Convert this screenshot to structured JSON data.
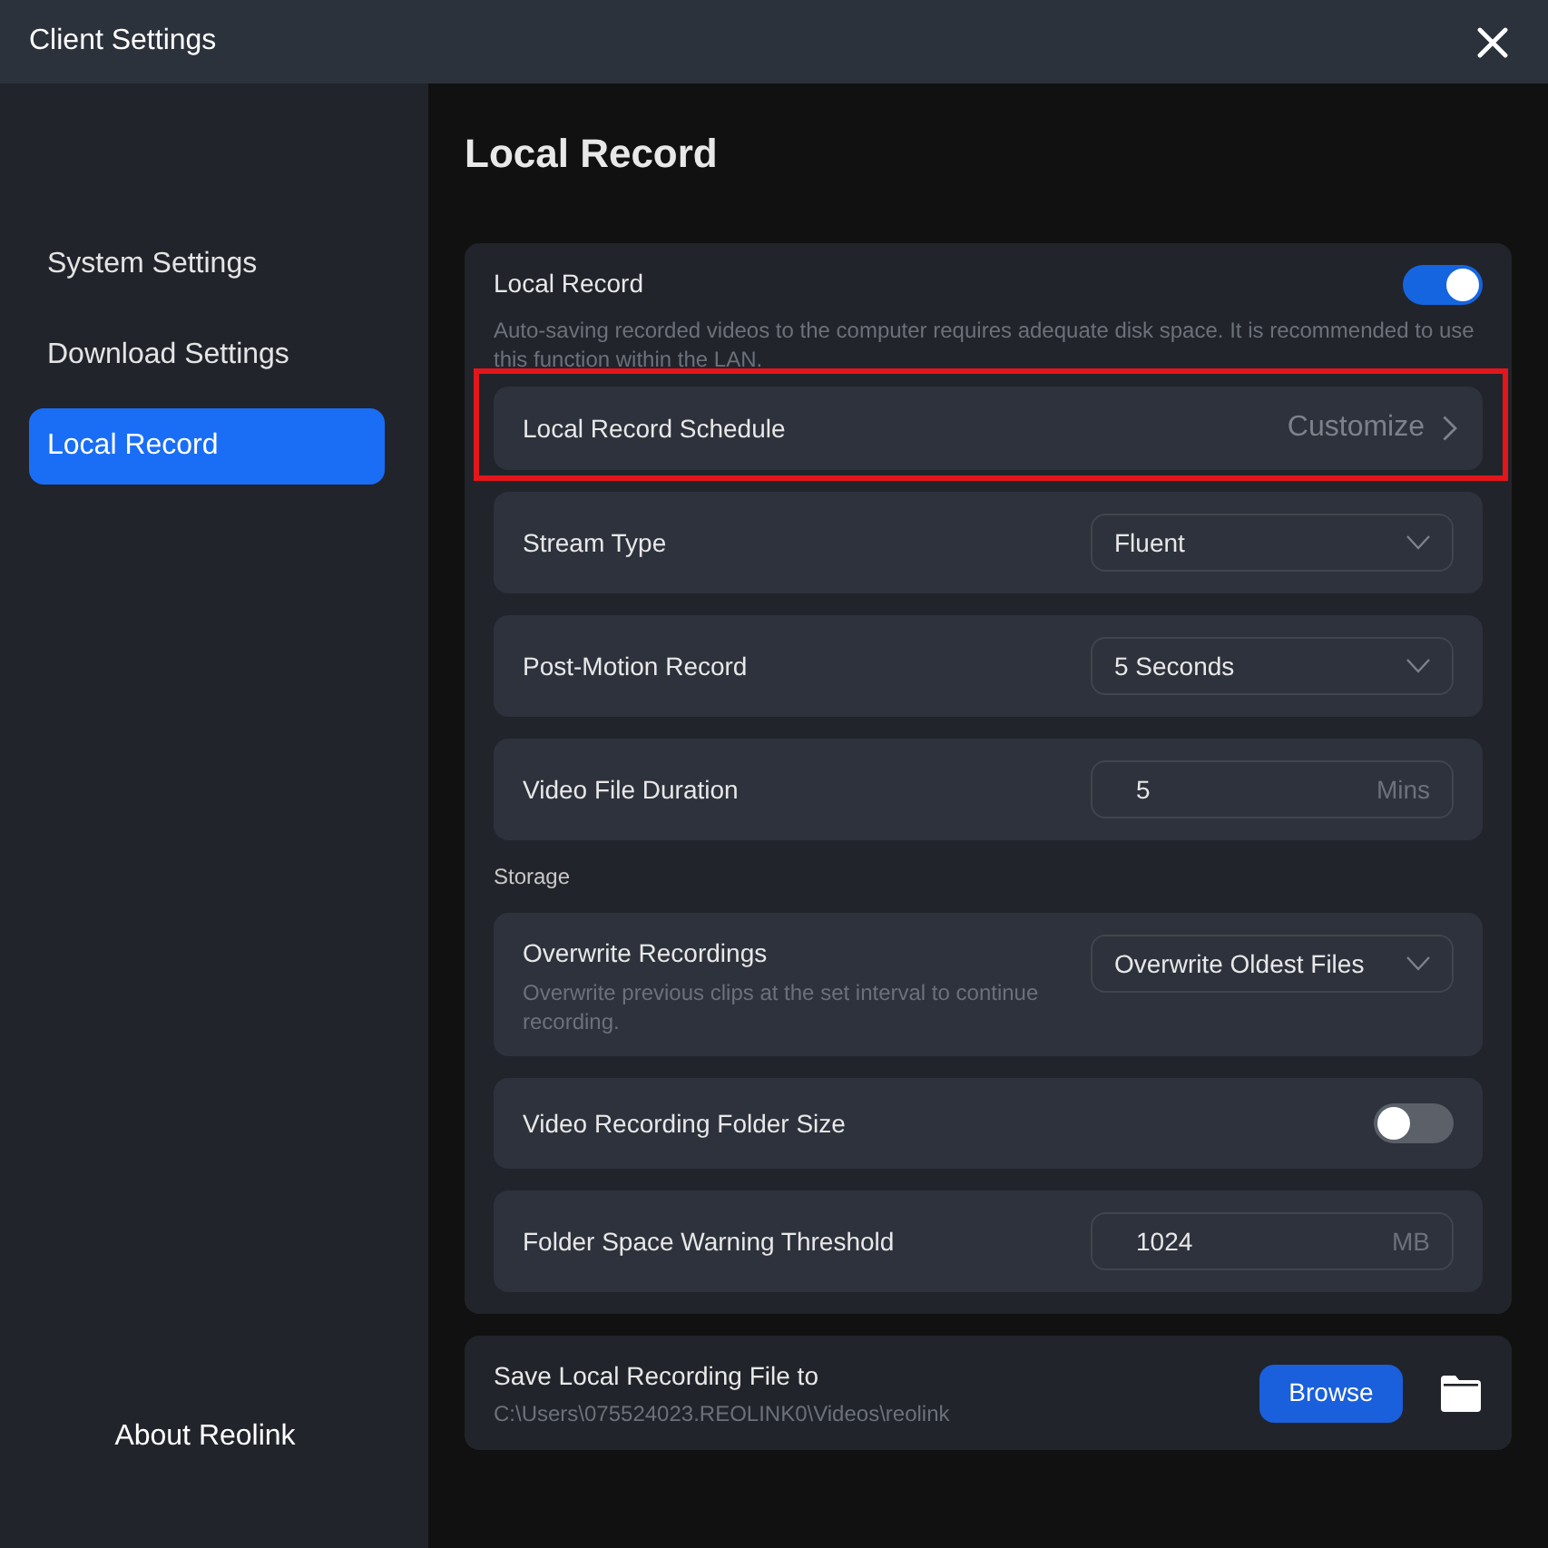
{
  "window": {
    "title": "Client Settings"
  },
  "sidebar": {
    "items": [
      {
        "label": "System Settings",
        "selected": false
      },
      {
        "label": "Download Settings",
        "selected": false
      },
      {
        "label": "Local Record",
        "selected": true
      }
    ],
    "footer_link": "About Reolink"
  },
  "page_title": "Local Record",
  "local_record": {
    "label": "Local Record",
    "on": true,
    "description": "Auto-saving recorded videos to the computer requires adequate disk space. It is recommended to use this function within the LAN."
  },
  "settings": [
    {
      "kind": "link",
      "label": "Local Record Schedule",
      "value": "Customize",
      "highlighted": true
    },
    {
      "kind": "select",
      "label": "Stream Type",
      "value": "Fluent"
    },
    {
      "kind": "select",
      "label": "Post-Motion Record",
      "value": "5 Seconds"
    },
    {
      "kind": "input",
      "label": "Video File Duration",
      "value": "5",
      "unit": "Mins"
    },
    {
      "kind": "section",
      "label": "Storage"
    },
    {
      "kind": "select",
      "label": "Overwrite Recordings",
      "description": "Overwrite previous clips at the set interval to continue recording.",
      "value": "Overwrite Oldest Files"
    },
    {
      "kind": "toggle",
      "label": "Video Recording Folder Size",
      "on": false
    },
    {
      "kind": "input",
      "label": "Folder Space Warning Threshold",
      "value": "1024",
      "unit": "MB"
    }
  ],
  "save_location": {
    "label": "Save Local Recording File to",
    "path": "C:\\Users\\075524023.REOLINK0\\Videos\\reolink",
    "button": "Browse"
  }
}
